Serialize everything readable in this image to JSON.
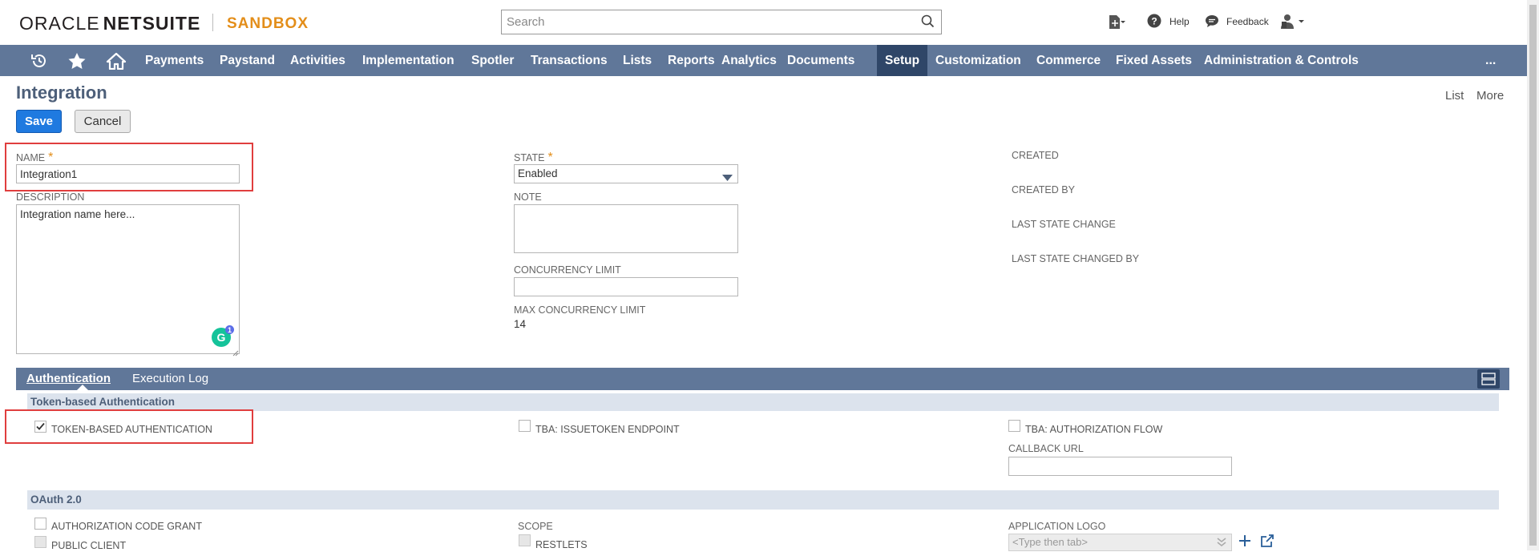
{
  "header": {
    "logo_oracle": "ORACLE",
    "logo_netsuite": "NETSUITE",
    "environment": "SANDBOX",
    "search_placeholder": "Search",
    "help_label": "Help",
    "feedback_label": "Feedback"
  },
  "nav": {
    "items": [
      "Payments",
      "Paystand",
      "Activities",
      "Implementation",
      "Spotler",
      "Transactions",
      "Lists",
      "Reports",
      "Analytics",
      "Documents",
      "Setup",
      "Customization",
      "Commerce",
      "Fixed Assets",
      "Administration & Controls"
    ],
    "active": "Setup",
    "more_label": "..."
  },
  "page": {
    "title": "Integration",
    "list_link": "List",
    "more_link": "More",
    "save_label": "Save",
    "cancel_label": "Cancel"
  },
  "form": {
    "name_label": "NAME",
    "name_required": "*",
    "name_value": "Integration1",
    "description_label": "DESCRIPTION",
    "description_value": "Integration name here...",
    "grammarly_badge": "1",
    "state_label": "STATE",
    "state_required": "*",
    "state_value": "Enabled",
    "note_label": "NOTE",
    "note_value": "",
    "concurrency_label": "CONCURRENCY LIMIT",
    "concurrency_value": "",
    "max_concurrency_label": "MAX CONCURRENCY LIMIT",
    "max_concurrency_value": "14",
    "created_label": "CREATED",
    "created_by_label": "CREATED BY",
    "last_state_change_label": "LAST STATE CHANGE",
    "last_state_changed_by_label": "LAST STATE CHANGED BY"
  },
  "tabs": {
    "authentication": "Authentication",
    "execution_log": "Execution Log"
  },
  "tba": {
    "section_title": "Token-based Authentication",
    "token_based_auth": "TOKEN-BASED AUTHENTICATION",
    "token_based_auth_checked": true,
    "issuetoken_endpoint": "TBA: ISSUETOKEN ENDPOINT",
    "authorization_flow": "TBA: AUTHORIZATION FLOW",
    "callback_url_label": "CALLBACK URL",
    "callback_url_value": ""
  },
  "oauth": {
    "section_title": "OAuth 2.0",
    "authorization_code_grant": "AUTHORIZATION CODE GRANT",
    "public_client": "PUBLIC CLIENT",
    "scope_label": "SCOPE",
    "restlets": "RESTLETS",
    "application_logo_label": "APPLICATION LOGO",
    "application_logo_placeholder": "<Type then tab>"
  },
  "colors": {
    "nav_bg": "#607799",
    "nav_active": "#2f4668",
    "accent_orange": "#e38e1a",
    "save_blue": "#1f7ae0",
    "highlight_red": "#e03e3e"
  }
}
